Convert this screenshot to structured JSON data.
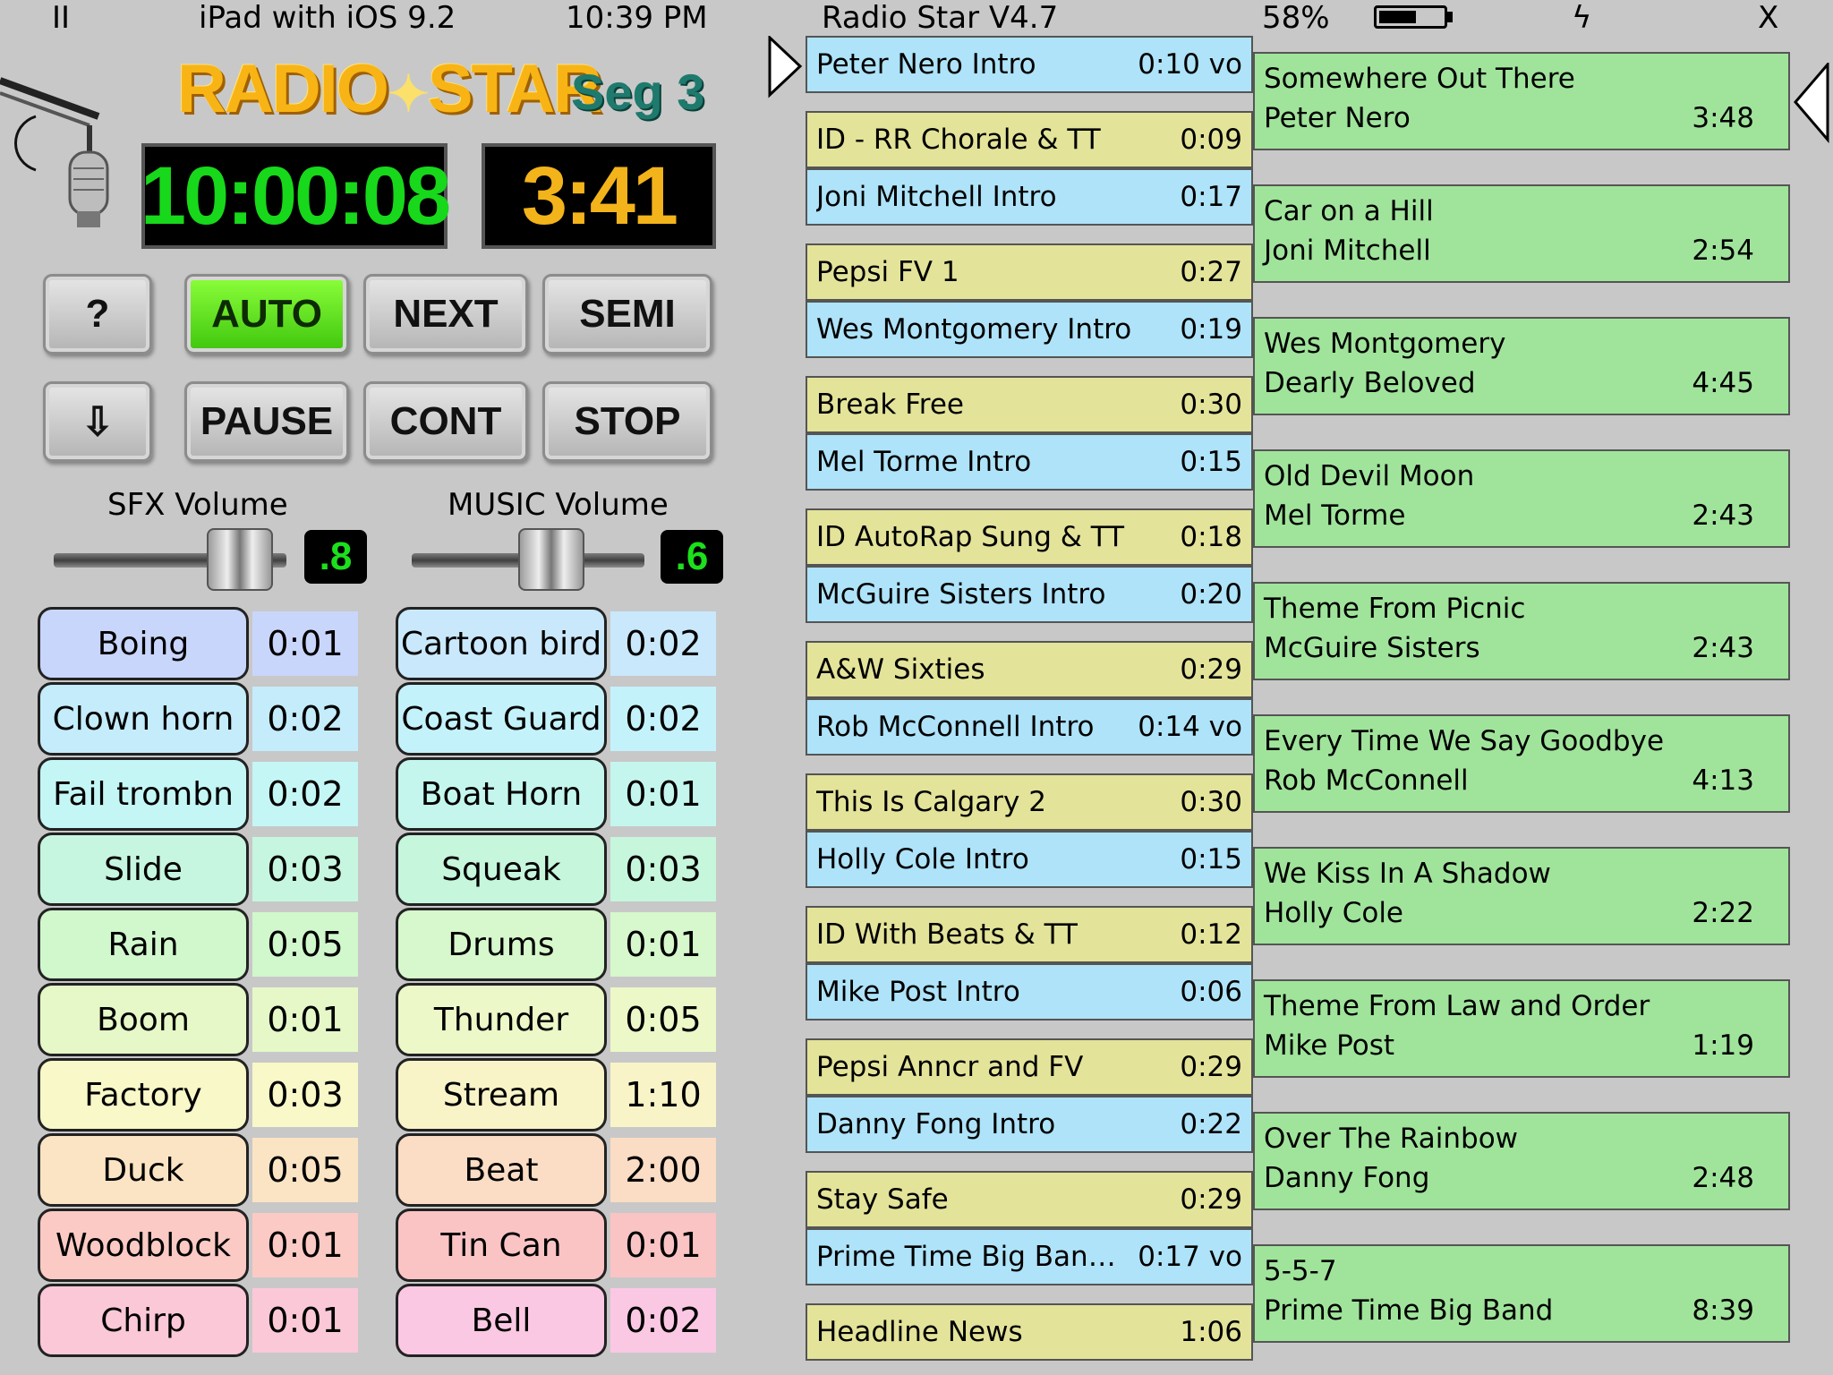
{
  "status": {
    "pause_glyph": "II",
    "device": "iPad with iOS 9.2",
    "time": "10:39 PM",
    "app": "Radio Star V4.7",
    "battery": "58%",
    "battery_level": 0.58,
    "charge_glyph": "ϟ",
    "close": "X"
  },
  "logo": {
    "left": "RADIO",
    "star": "✦",
    "right": "STAR",
    "segment": "Seg 3"
  },
  "clocks": {
    "time": "10:00:08",
    "remaining": "3:41"
  },
  "buttons": {
    "help": "?",
    "auto": "AUTO",
    "next": "NEXT",
    "semi": "SEMI",
    "down": "⇩",
    "pause": "PAUSE",
    "cont": "CONT",
    "stop": "STOP"
  },
  "volume": {
    "sfx_label": "SFX Volume",
    "sfx_value": ".8",
    "sfx_level": 0.8,
    "music_label": "MUSIC Volume",
    "music_value": ".6",
    "music_level": 0.6
  },
  "sfx_left": [
    {
      "name": "Boing",
      "dur": "0:01",
      "color": "#c9d6fb",
      "durbg": "#c9d6fb"
    },
    {
      "name": "Clown horn",
      "dur": "0:02",
      "color": "#c4ecfb",
      "durbg": "#c4ecfb"
    },
    {
      "name": "Fail trombn",
      "dur": "0:02",
      "color": "#c4f6f5",
      "durbg": "#c4f6f5"
    },
    {
      "name": "Slide",
      "dur": "0:03",
      "color": "#c6f6e0",
      "durbg": "#c6f6e0"
    },
    {
      "name": "Rain",
      "dur": "0:05",
      "color": "#d0f8cc",
      "durbg": "#d0f8cc"
    },
    {
      "name": "Boom",
      "dur": "0:01",
      "color": "#e6f8c8",
      "durbg": "#e6f8c8"
    },
    {
      "name": "Factory",
      "dur": "0:03",
      "color": "#f8f8c8",
      "durbg": "#f8f8c8"
    },
    {
      "name": "Duck",
      "dur": "0:05",
      "color": "#fbe4c4",
      "durbg": "#fbe4c4"
    },
    {
      "name": "Woodblock",
      "dur": "0:01",
      "color": "#fbcac4",
      "durbg": "#fbcac4"
    },
    {
      "name": "Chirp",
      "dur": "0:01",
      "color": "#fbc8d8",
      "durbg": "#fbc8d8"
    }
  ],
  "sfx_right": [
    {
      "name": "Cartoon bird",
      "dur": "0:02",
      "color": "#c9e8fb",
      "durbg": "#c9e8fb"
    },
    {
      "name": "Coast Guard",
      "dur": "0:02",
      "color": "#c4f2fb",
      "durbg": "#c4f2fb"
    },
    {
      "name": "Boat Horn",
      "dur": "0:01",
      "color": "#c4f6ee",
      "durbg": "#c4f6ee"
    },
    {
      "name": "Squeak",
      "dur": "0:03",
      "color": "#c6f6dc",
      "durbg": "#c6f6dc"
    },
    {
      "name": "Drums",
      "dur": "0:01",
      "color": "#d6f8cc",
      "durbg": "#d6f8cc"
    },
    {
      "name": "Thunder",
      "dur": "0:05",
      "color": "#ecf8c8",
      "durbg": "#ecf8c8"
    },
    {
      "name": "Stream",
      "dur": "1:10",
      "color": "#f8f4c8",
      "durbg": "#f8f4c8"
    },
    {
      "name": "Beat",
      "dur": "2:00",
      "color": "#fbdcc4",
      "durbg": "#fbdcc4"
    },
    {
      "name": "Tin Can",
      "dur": "0:01",
      "color": "#fbc4c4",
      "durbg": "#fbc4c4"
    },
    {
      "name": "Bell",
      "dur": "0:02",
      "color": "#fbc8e4",
      "durbg": "#fbc8e4"
    }
  ],
  "queue": [
    {
      "title": "Peter Nero Intro",
      "dur": "0:10 vo",
      "kind": "blue"
    },
    {
      "title": "ID - RR Chorale & TT",
      "dur": "0:09",
      "kind": "yellow"
    },
    {
      "title": "Joni Mitchell Intro",
      "dur": "0:17",
      "kind": "blue"
    },
    {
      "title": "Pepsi FV 1",
      "dur": "0:27",
      "kind": "yellow"
    },
    {
      "title": "Wes Montgomery Intro",
      "dur": "0:19",
      "kind": "blue"
    },
    {
      "title": "Break Free",
      "dur": "0:30",
      "kind": "yellow"
    },
    {
      "title": "Mel Torme Intro",
      "dur": "0:15",
      "kind": "blue"
    },
    {
      "title": "ID AutoRap Sung & TT",
      "dur": "0:18",
      "kind": "yellow"
    },
    {
      "title": "McGuire Sisters Intro",
      "dur": "0:20",
      "kind": "blue"
    },
    {
      "title": "A&W Sixties",
      "dur": "0:29",
      "kind": "yellow"
    },
    {
      "title": "Rob McConnell Intro",
      "dur": "0:14 vo",
      "kind": "blue"
    },
    {
      "title": "This Is Calgary 2",
      "dur": "0:30",
      "kind": "yellow"
    },
    {
      "title": "Holly Cole Intro",
      "dur": "0:15",
      "kind": "blue"
    },
    {
      "title": "ID With Beats & TT",
      "dur": "0:12",
      "kind": "yellow"
    },
    {
      "title": "Mike Post Intro",
      "dur": "0:06",
      "kind": "blue"
    },
    {
      "title": "Pepsi Anncr and FV",
      "dur": "0:29",
      "kind": "yellow"
    },
    {
      "title": "Danny Fong Intro",
      "dur": "0:22",
      "kind": "blue"
    },
    {
      "title": "Stay Safe",
      "dur": "0:29",
      "kind": "yellow"
    },
    {
      "title": "Prime Time Big Band I...",
      "dur": "0:17 vo",
      "kind": "blue"
    },
    {
      "title": "Headline News",
      "dur": "1:06",
      "kind": "yellow"
    }
  ],
  "songs": [
    {
      "title": "Somewhere Out There",
      "artist": "Peter Nero",
      "dur": "3:48"
    },
    {
      "title": "Car on a Hill",
      "artist": "Joni Mitchell",
      "dur": "2:54"
    },
    {
      "title": "Wes Montgomery",
      "artist": "Dearly Beloved",
      "dur": "4:45"
    },
    {
      "title": "Old Devil Moon",
      "artist": "Mel Torme",
      "dur": "2:43"
    },
    {
      "title": "Theme From Picnic",
      "artist": "McGuire Sisters",
      "dur": "2:43"
    },
    {
      "title": "Every Time We Say Goodbye",
      "artist": "Rob McConnell",
      "dur": "4:13"
    },
    {
      "title": "We Kiss In A Shadow",
      "artist": "Holly Cole",
      "dur": "2:22"
    },
    {
      "title": "Theme From Law and Order",
      "artist": "Mike Post",
      "dur": "1:19"
    },
    {
      "title": "Over The Rainbow",
      "artist": "Danny Fong",
      "dur": "2:48"
    },
    {
      "title": "5-5-7",
      "artist": "Prime Time Big Band",
      "dur": "8:39"
    }
  ]
}
